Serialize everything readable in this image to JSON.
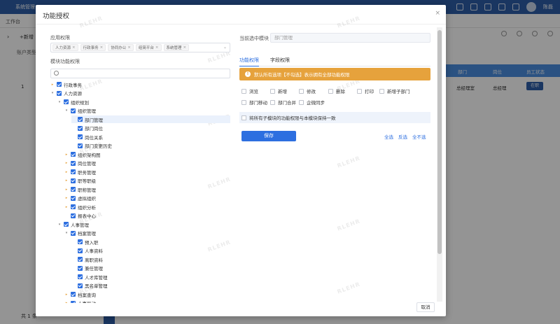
{
  "background": {
    "topbar_title": "系统管理",
    "user_name": "陈磊",
    "tab_label": "工作台",
    "add_label": "+新增",
    "account_type_label": "账户类型",
    "row_number": "1",
    "table_headers": [
      "部门",
      "岗位",
      "员工状态"
    ],
    "row_cells": [
      "总经理室",
      "总经理"
    ],
    "row_button": "在职",
    "footer_text": "共 1 条"
  },
  "modal": {
    "title": "功能授权",
    "close_glyph": "×",
    "app_permission_label": "应用权限",
    "app_tags": [
      "人力资源",
      "行政事务",
      "协同办公",
      "组简平台",
      "系统管理"
    ],
    "tag_remove_glyph": "×",
    "module_permission_label": "模块功能权限",
    "tree": [
      {
        "label": "行政事务",
        "level": 0,
        "arrow": "▸"
      },
      {
        "label": "人力资源",
        "level": 0,
        "arrow": "▾"
      },
      {
        "label": "组织规划",
        "level": 1,
        "arrow": "▾"
      },
      {
        "label": "组织管理",
        "level": 2,
        "arrow": "▾"
      },
      {
        "label": "部门管理",
        "level": 3,
        "arrow": "",
        "selected": true
      },
      {
        "label": "部门岗位",
        "level": 3,
        "arrow": ""
      },
      {
        "label": "岗位关系",
        "level": 3,
        "arrow": ""
      },
      {
        "label": "部门变更历史",
        "level": 3,
        "arrow": ""
      },
      {
        "label": "组织架构图",
        "level": 2,
        "arrow": "▸"
      },
      {
        "label": "岗位管理",
        "level": 2,
        "arrow": "▸"
      },
      {
        "label": "职务管理",
        "level": 2,
        "arrow": "▸"
      },
      {
        "label": "职等职级",
        "level": 2,
        "arrow": "▸"
      },
      {
        "label": "职称管理",
        "level": 2,
        "arrow": "▸"
      },
      {
        "label": "虚拟组织",
        "level": 2,
        "arrow": "▸"
      },
      {
        "label": "组织分析",
        "level": 2,
        "arrow": "▸"
      },
      {
        "label": "报表中心",
        "level": 2,
        "arrow": ""
      },
      {
        "label": "人事管理",
        "level": 1,
        "arrow": "▾"
      },
      {
        "label": "档案管理",
        "level": 2,
        "arrow": "▾"
      },
      {
        "label": "预入职",
        "level": 3,
        "arrow": ""
      },
      {
        "label": "人事资料",
        "level": 3,
        "arrow": ""
      },
      {
        "label": "离职资料",
        "level": 3,
        "arrow": ""
      },
      {
        "label": "兼任管理",
        "level": 3,
        "arrow": ""
      },
      {
        "label": "人才库管理",
        "level": 3,
        "arrow": ""
      },
      {
        "label": "黑名单管理",
        "level": 3,
        "arrow": ""
      },
      {
        "label": "档案查询",
        "level": 2,
        "arrow": "▸"
      },
      {
        "label": "人事异动",
        "level": 2,
        "arrow": "▸"
      }
    ],
    "current_module_label": "当前选中模块",
    "current_module_value": "部门管理",
    "tabs": [
      "功能权限",
      "字段权限"
    ],
    "warning_text": "默认所有选项【不勾选】表示拥有全部功能权限",
    "warning_icon": "!",
    "permissions": [
      "浏览",
      "新增",
      "修改",
      "删除",
      "打印",
      "新增子部门",
      "部门移动",
      "部门合并",
      "企微同步"
    ],
    "sync_text": "将所有子模块的功能权限与本模块保持一致",
    "save_label": "保存",
    "select_all": "全选",
    "invert_select": "反选",
    "deselect_all": "全不选",
    "cancel_label": "取消",
    "watermark": "RLEHR"
  }
}
